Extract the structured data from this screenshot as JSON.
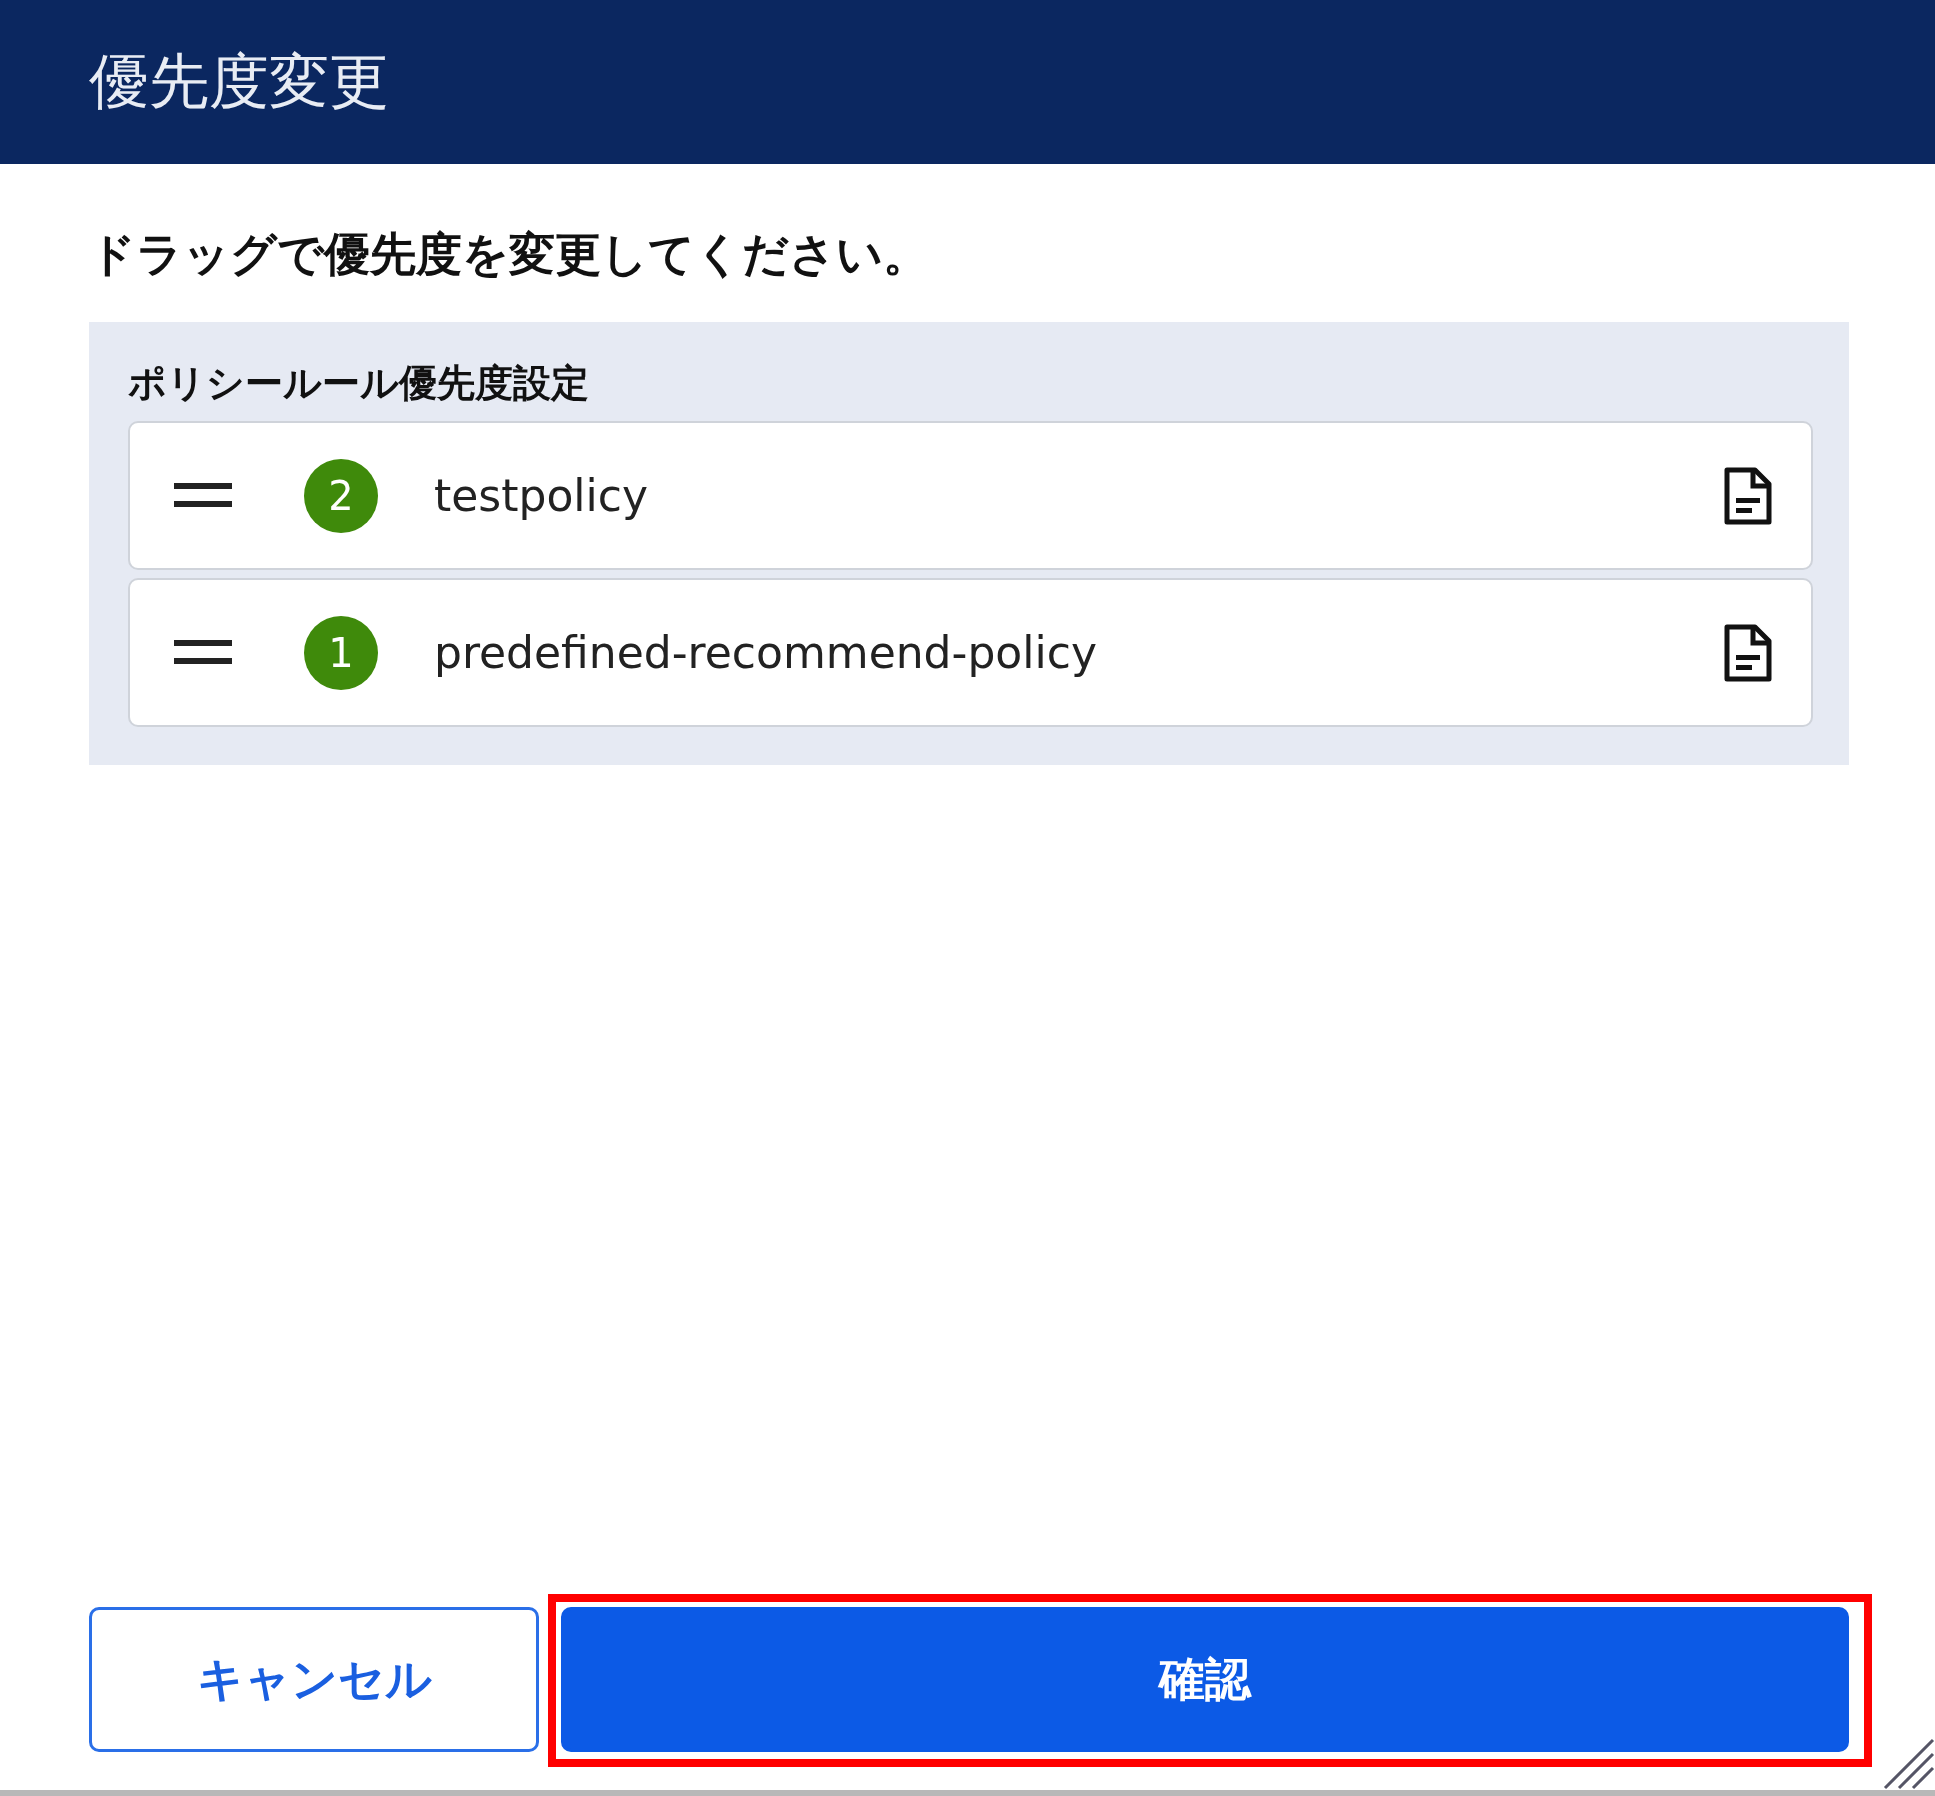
{
  "dialog": {
    "title": "優先度変更"
  },
  "instruction": "ドラッグで優先度を変更してください。",
  "panel": {
    "label": "ポリシールール優先度設定",
    "items": [
      {
        "priority": "2",
        "name": "testpolicy"
      },
      {
        "priority": "1",
        "name": "predefined-recommend-policy"
      }
    ]
  },
  "buttons": [
    {
      "label": "キャンセル",
      "kind": "secondary",
      "highlighted": false
    },
    {
      "label": "確認",
      "kind": "primary",
      "highlighted": true
    }
  ]
}
